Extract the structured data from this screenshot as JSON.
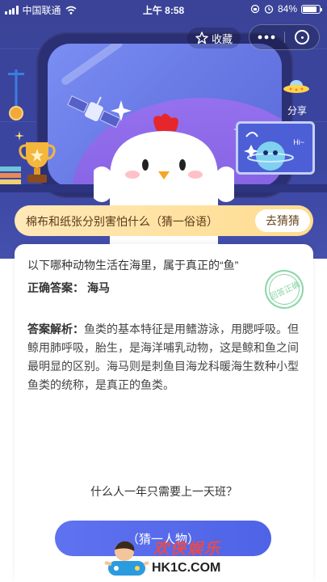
{
  "status_bar": {
    "carrier": "中国联通",
    "time": "上午 8:58",
    "battery": "84%",
    "battery_level": 0.84
  },
  "toolbar": {
    "favorite_label": "收藏",
    "share_label": "分享"
  },
  "alien_board": {
    "speech": "Hi~"
  },
  "banner": {
    "text": "棉布和纸张分别害怕什么（猜一俗语）",
    "button": "去猜猜"
  },
  "card": {
    "question": "以下哪种动物生活在海里，属于真正的“鱼”",
    "answer_label": "正确答案：",
    "answer_value": "海马",
    "stamp_text": "回答正确",
    "analysis_label": "答案解析：",
    "analysis_text": "鱼类的基本特征是用鳍游泳，用腮呼吸。但鲸用肺呼吸，胎生，是海洋哺乳动物，这是鲸和鱼之间最明显的区别。海马则是刺鱼目海龙科暖海生数种小型鱼类的统称，是真正的鱼类。",
    "next_question": "什么人一年只需要上一天班？",
    "next_button": "（猜一人物）"
  },
  "watermark": {
    "cn": "欢侠娱乐",
    "en": "HK1C.COM"
  },
  "colors": {
    "hero_bg": "#3a4397",
    "banner_bg": "#ffdc8f",
    "button_bg": "#5f72f0",
    "stamp": "#8ad6a6"
  }
}
